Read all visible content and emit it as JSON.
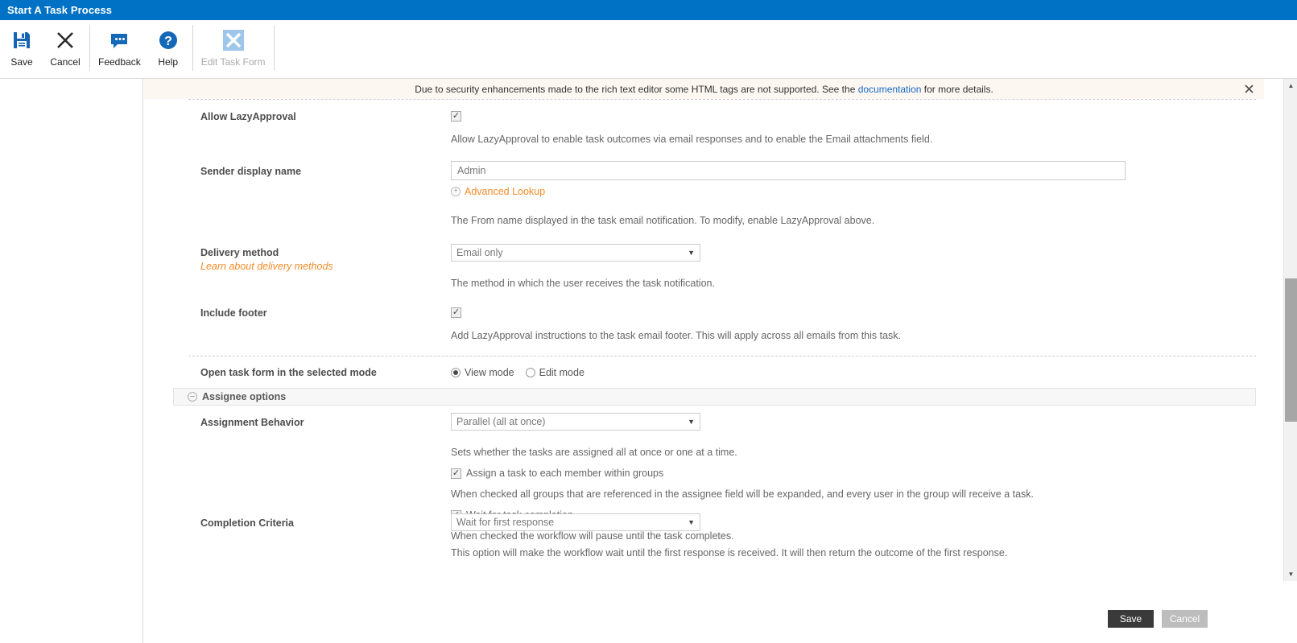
{
  "window": {
    "title": "Start A Task Process"
  },
  "toolbar": {
    "items": [
      {
        "label": "Save",
        "icon": "save-icon",
        "disabled": false
      },
      {
        "label": "Cancel",
        "icon": "close-x-icon",
        "disabled": false
      },
      {
        "label": "Feedback",
        "icon": "speech-bubble-icon",
        "disabled": false
      },
      {
        "label": "Help",
        "icon": "question-mark-icon",
        "disabled": false
      },
      {
        "label": "Edit Task Form",
        "icon": "x-form-icon",
        "disabled": true
      }
    ]
  },
  "notice": {
    "text_before": "Due to security enhancements made to the rich text editor some HTML tags are not supported. See the ",
    "link": "documentation",
    "text_after": " for more details.",
    "close_icon": "close-icon"
  },
  "form": {
    "allow_lazy_approval": {
      "label": "Allow LazyApproval",
      "checked": true,
      "hint": "Allow LazyApproval to enable task outcomes via email responses and to enable the Email attachments field."
    },
    "sender_display_name": {
      "label": "Sender display name",
      "value": "Admin",
      "lookup_label": "Advanced Lookup",
      "lookup_icon": "circle-plus-icon",
      "hint": "The From name displayed in the task email notification. To modify, enable LazyApproval above."
    },
    "delivery_method": {
      "label": "Delivery method",
      "sublink": "Learn about delivery methods",
      "value": "Email only",
      "options": [
        "Email only"
      ],
      "hint": "The method in which the user receives the task notification."
    },
    "include_footer": {
      "label": "Include footer",
      "checked": true,
      "hint": "Add LazyApproval instructions to the task email footer. This will apply across all emails from this task."
    },
    "open_task_form_mode": {
      "label": "Open task form in the selected mode",
      "options": [
        {
          "label": "View mode",
          "selected": true
        },
        {
          "label": "Edit mode",
          "selected": false
        }
      ]
    },
    "assignee_options": {
      "section_title": "Assignee options",
      "section_icon": "collapse-minus-icon",
      "assignment_behavior": {
        "label": "Assignment Behavior",
        "value": "Parallel (all at once)",
        "options": [
          "Parallel (all at once)"
        ],
        "hint": "Sets whether the tasks are assigned all at once or one at a time."
      },
      "assign_each_member": {
        "label": "Assign a task to each member within groups",
        "checked": true,
        "hint": "When checked all groups that are referenced in the assignee field will be expanded, and every user in the group will receive a task."
      },
      "wait_for_task_completion": {
        "label": "Wait for task completion",
        "checked": true,
        "hint": "When checked the workflow will pause until the task completes."
      },
      "completion_criteria": {
        "label": "Completion Criteria",
        "value": "Wait for first response",
        "options": [
          "Wait for first response"
        ],
        "hint": "This option will make the workflow wait until the first response is received. It will then return the outcome of the first response."
      }
    }
  },
  "footer": {
    "save_label": "Save",
    "cancel_label": "Cancel"
  },
  "scrollbar": {
    "up_icon": "triangle-up-icon",
    "down_icon": "triangle-down-icon"
  }
}
